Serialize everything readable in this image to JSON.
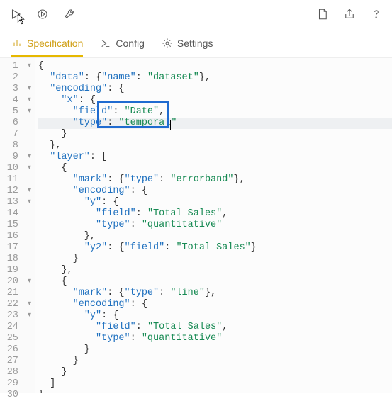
{
  "tabs": {
    "spec": "Specification",
    "config": "Config",
    "settings": "Settings"
  },
  "code": {
    "l1": "{",
    "l2a": "  ",
    "l2k": "\"data\"",
    "l2b": ": {",
    "l2k2": "\"name\"",
    "l2c": ": ",
    "l2s": "\"dataset\"",
    "l2d": "},",
    "l3a": "  ",
    "l3k": "\"encoding\"",
    "l3b": ": {",
    "l4a": "    ",
    "l4k": "\"x\"",
    "l4b": ": {",
    "l5a": "      ",
    "l5k": "\"field\"",
    "l5b": ": ",
    "l5s": "\"Date\"",
    "l5c": ",",
    "l6a": "      ",
    "l6k": "\"type\"",
    "l6b": ": ",
    "l6s1": "\"temporal",
    "l6s2": "\"",
    "l7": "    }",
    "l8": "  },",
    "l9a": "  ",
    "l9k": "\"layer\"",
    "l9b": ": [",
    "l10": "    {",
    "l11a": "      ",
    "l11k": "\"mark\"",
    "l11b": ": {",
    "l11k2": "\"type\"",
    "l11c": ": ",
    "l11s": "\"errorband\"",
    "l11d": "},",
    "l12a": "      ",
    "l12k": "\"encoding\"",
    "l12b": ": {",
    "l13a": "        ",
    "l13k": "\"y\"",
    "l13b": ": {",
    "l14a": "          ",
    "l14k": "\"field\"",
    "l14b": ": ",
    "l14s": "\"Total Sales\"",
    "l14c": ",",
    "l15a": "          ",
    "l15k": "\"type\"",
    "l15b": ": ",
    "l15s": "\"quantitative\"",
    "l16": "        },",
    "l17a": "        ",
    "l17k": "\"y2\"",
    "l17b": ": {",
    "l17k2": "\"field\"",
    "l17c": ": ",
    "l17s": "\"Total Sales\"",
    "l17d": "}",
    "l18": "      }",
    "l19": "    },",
    "l20": "    {",
    "l21a": "      ",
    "l21k": "\"mark\"",
    "l21b": ": {",
    "l21k2": "\"type\"",
    "l21c": ": ",
    "l21s": "\"line\"",
    "l21d": "},",
    "l22a": "      ",
    "l22k": "\"encoding\"",
    "l22b": ": {",
    "l23a": "        ",
    "l23k": "\"y\"",
    "l23b": ": {",
    "l24a": "          ",
    "l24k": "\"field\"",
    "l24b": ": ",
    "l24s": "\"Total Sales\"",
    "l24c": ",",
    "l25a": "          ",
    "l25k": "\"type\"",
    "l25b": ": ",
    "l25s": "\"quantitative\"",
    "l26": "        }",
    "l27": "      }",
    "l28": "    }",
    "l29": "  ]",
    "l30": "}"
  },
  "line_numbers": [
    "1",
    "2",
    "3",
    "4",
    "5",
    "6",
    "7",
    "8",
    "9",
    "10",
    "11",
    "12",
    "13",
    "14",
    "15",
    "16",
    "17",
    "18",
    "19",
    "20",
    "21",
    "22",
    "23",
    "24",
    "25",
    "26",
    "27",
    "28",
    "29",
    "30"
  ],
  "folds": [
    1,
    3,
    4,
    5,
    9,
    10,
    12,
    13,
    20,
    22,
    23
  ]
}
